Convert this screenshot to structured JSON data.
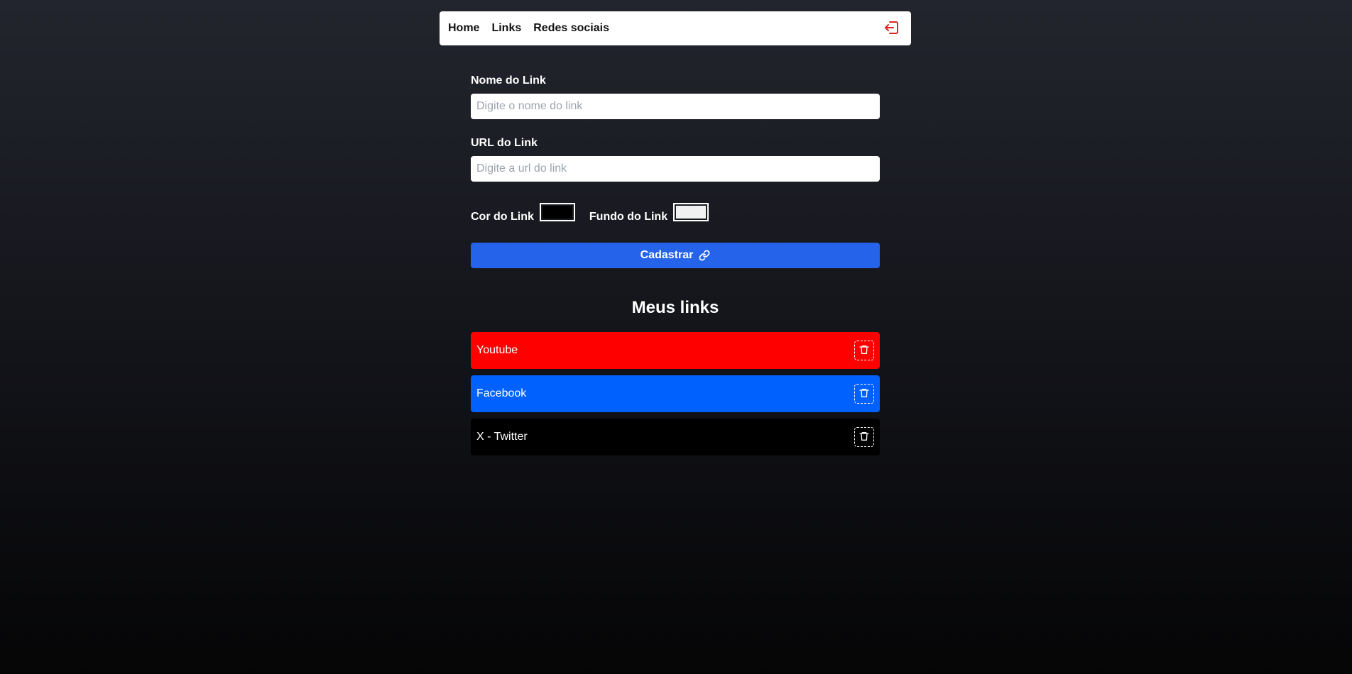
{
  "nav": {
    "items": [
      {
        "label": "Home"
      },
      {
        "label": "Links"
      },
      {
        "label": "Redes sociais"
      }
    ],
    "logout_icon": "logout-icon",
    "logout_color": "#dc2626"
  },
  "form": {
    "name_label": "Nome do Link",
    "name_placeholder": "Digite o nome do link",
    "name_value": "",
    "url_label": "URL do Link",
    "url_placeholder": "Digite a url do link",
    "url_value": "",
    "color_label": "Cor do Link",
    "color_value": "#000000",
    "bg_label": "Fundo do Link",
    "bg_value": "#f1f1f1",
    "submit_label": "Cadastrar",
    "submit_icon": "link-icon",
    "submit_color": "#2563eb"
  },
  "links_section": {
    "title": "Meus links",
    "items": [
      {
        "name": "Youtube",
        "bg": "#ff0000",
        "color": "#ffffff"
      },
      {
        "name": "Facebook",
        "bg": "#0061ff",
        "color": "#ffffff"
      },
      {
        "name": "X - Twitter",
        "bg": "#000000",
        "color": "#ffffff"
      }
    ],
    "delete_icon": "trash-icon"
  }
}
